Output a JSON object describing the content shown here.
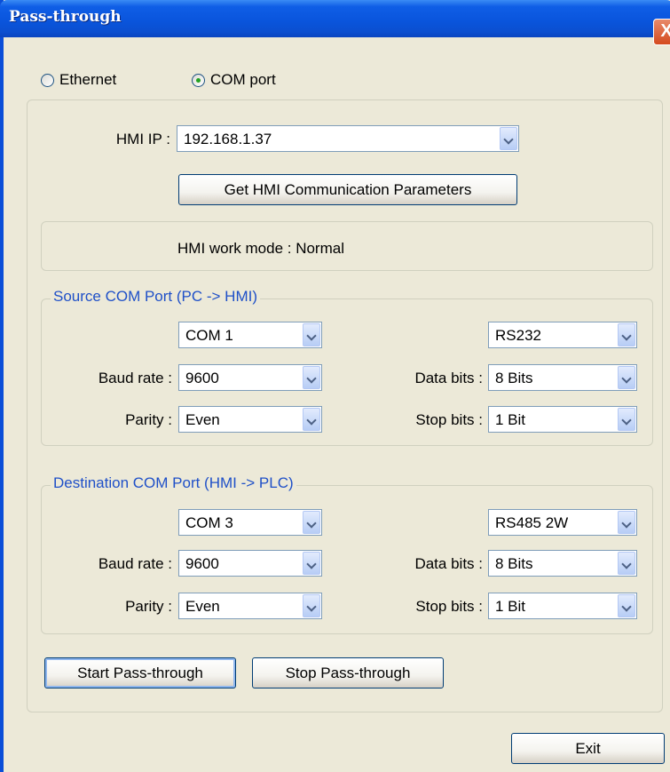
{
  "window": {
    "title": "Pass-through",
    "close_label": "X"
  },
  "connection": {
    "ethernet_label": "Ethernet",
    "com_label": "COM port",
    "selected": "COM port"
  },
  "hmi": {
    "ip_label": "HMI IP :",
    "ip_value": "192.168.1.37",
    "get_params_label": "Get HMI  Communication Parameters",
    "work_mode_text": "HMI work mode :  Normal"
  },
  "source": {
    "title": "Source COM Port (PC -> HMI)",
    "port": "COM 1",
    "interface": "RS232",
    "baud_label": "Baud rate :",
    "baud": "9600",
    "data_bits_label": "Data bits :",
    "data_bits": "8 Bits",
    "parity_label": "Parity :",
    "parity": "Even",
    "stop_bits_label": "Stop bits :",
    "stop_bits": "1 Bit"
  },
  "destination": {
    "title": "Destination COM Port (HMI -> PLC)",
    "port": "COM 3",
    "interface": "RS485 2W",
    "baud_label": "Baud rate :",
    "baud": "9600",
    "data_bits_label": "Data bits :",
    "data_bits": "8 Bits",
    "parity_label": "Parity :",
    "parity": "Even",
    "stop_bits_label": "Stop bits :",
    "stop_bits": "1 Bit"
  },
  "actions": {
    "start_label": "Start Pass-through",
    "stop_label": "Stop Pass-through",
    "exit_label": "Exit"
  },
  "theme": {
    "titlebar": "#0a55dd",
    "dialog_bg": "#ece9d8",
    "group_title": "#1f50c8",
    "radio_dot": "#21a121"
  }
}
